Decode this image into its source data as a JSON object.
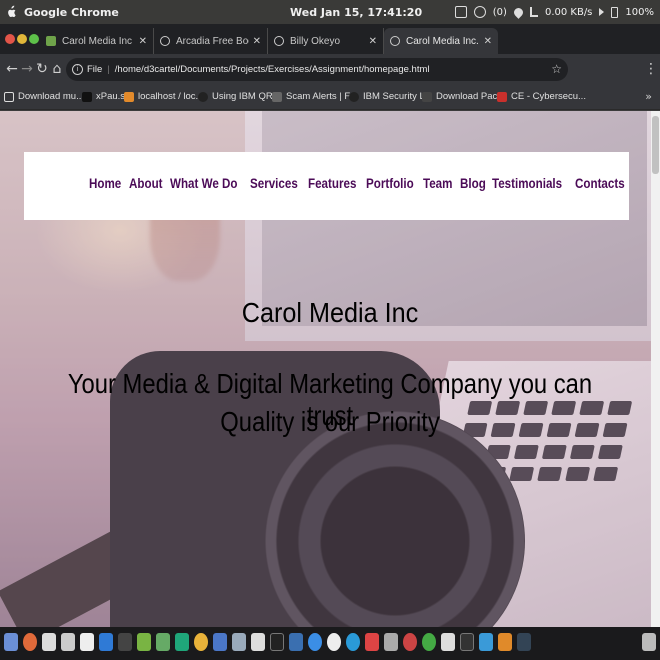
{
  "os": {
    "app_name": "Google Chrome",
    "clock": "Wed Jan 15, 17:41:20",
    "notif_count": "(0)",
    "net_speed": "0.00 KB/s",
    "battery": "100%"
  },
  "tabs": [
    {
      "label": "Carol Media Inc",
      "active": false
    },
    {
      "label": "Arcadia Free Bootstrap T",
      "active": false
    },
    {
      "label": "Billy Okeyo",
      "active": false
    },
    {
      "label": "Carol Media Inc.",
      "active": true
    }
  ],
  "toolbar": {
    "scheme": "File",
    "url": "/home/d3cartel/Documents/Projects/Exercises/Assignment/homepage.html"
  },
  "bookmarks": [
    "Download mu...",
    "xPau.se",
    "localhost / loc...",
    "Using IBM QR...",
    "Scam Alerts | F...",
    "IBM Security L...",
    "Download Pac...",
    "CE - Cybersecu..."
  ],
  "site": {
    "nav": [
      "Home",
      "About",
      "What We Do",
      "Services",
      "Features",
      "Portfolio",
      "Team",
      "Blog",
      "Testimonials",
      "Contacts"
    ],
    "title": "Carol Media Inc",
    "tagline": "Your Media & Digital Marketing Company you can trust",
    "subtitle": "Quality is our Priority"
  },
  "colors": {
    "nav_text": "#4b0b57",
    "hero_text": "#000000"
  }
}
